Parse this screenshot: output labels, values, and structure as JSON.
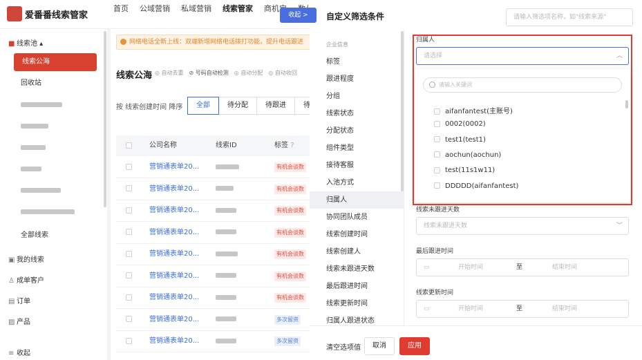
{
  "app": {
    "brand": "爱番番线索管家"
  },
  "topnav": [
    "首页",
    "公域营销",
    "私域营销",
    "线索管家",
    "商机宝",
    "数从"
  ],
  "sidebar": {
    "group_pool": "线索池",
    "items": [
      {
        "label": "线索公海",
        "selected": true
      },
      {
        "label": "回收站"
      },
      {
        "label": "全部线索"
      }
    ],
    "my_leads": "我的线索",
    "customers": "成单客户",
    "orders": "订单",
    "products": "产品",
    "collapse": "收起"
  },
  "main": {
    "notice": "网络电话全新上线：双端新增网络电话拨打功能，提升电话跟进",
    "title": "线索公海",
    "options": [
      "自动去重",
      "号码自动检测",
      "自动分配",
      "自动收回"
    ],
    "sort_label": "按 线索创建时间 降序",
    "tabs": [
      "全部",
      "待分配",
      "待跟进",
      "待"
    ],
    "columns": [
      "公司名称",
      "线索ID",
      "标签"
    ],
    "rows": [
      {
        "company": "营销通表单20...",
        "tag": "有机会谈数",
        "tag_color": "red"
      },
      {
        "company": "营销通表单20...",
        "tag": "有机会谈数",
        "tag_color": "red"
      },
      {
        "company": "营销通表单20...",
        "tag": "有机会谈数",
        "tag_color": "red"
      },
      {
        "company": "营销通表单20...",
        "tag": "有机会谈数",
        "tag_color": "red"
      },
      {
        "company": "营销通表单20...",
        "tag": "有机会谈数",
        "tag_color": "red"
      },
      {
        "company": "营销通表单20...",
        "tag": "有机会谈数",
        "tag_color": "red"
      },
      {
        "company": "营销通表单20...",
        "tag": "有机会谈数",
        "tag_color": "red"
      },
      {
        "company": "营销通表单20...",
        "tag": "多次留资",
        "tag_color": "blue"
      },
      {
        "company": "营销通表单20...",
        "tag": "多次留资",
        "tag_color": "blue"
      }
    ]
  },
  "filter": {
    "title": "自定义筛选条件",
    "search_placeholder": "请输入筛选项名称，如\"线索来源\"",
    "collapse_label": "收起 >",
    "categories": [
      {
        "label": "企业信息",
        "header": true
      },
      {
        "label": "标签"
      },
      {
        "label": "跟进程度"
      },
      {
        "label": "分组"
      },
      {
        "label": "线索状态"
      },
      {
        "label": "分配状态"
      },
      {
        "label": "组件类型"
      },
      {
        "label": "接待客服"
      },
      {
        "label": "入池方式"
      },
      {
        "label": "归属人",
        "selected": true
      },
      {
        "label": "协同团队成员"
      },
      {
        "label": "线索创建时间"
      },
      {
        "label": "线索创建人"
      },
      {
        "label": "线索未跟进天数"
      },
      {
        "label": "最后跟进时间"
      },
      {
        "label": "线索更新时间"
      },
      {
        "label": "归属人跟进状态"
      }
    ],
    "owner": {
      "label": "归属人",
      "placeholder": "请选择",
      "search_placeholder": "请输入关键词",
      "options": [
        "aifanfantest(主账号)",
        "0002(0002)",
        "test1(test1)",
        "aochun(aochun)",
        "test(11s1w11)",
        "DDDDD(aifanfantest)"
      ]
    },
    "not_followed_days": {
      "label": "线索未跟进天数",
      "placeholder": "线索未跟进天数"
    },
    "last_follow_time": {
      "label": "最后跟进时间",
      "start": "开始时间",
      "sep": "至",
      "end": "结束时间"
    },
    "update_time": {
      "label": "线索更新时间",
      "start": "开始时间",
      "sep": "至",
      "end": "结束时间"
    },
    "footer": {
      "clear": "清空选项值",
      "cancel": "取消",
      "apply": "应用"
    }
  },
  "colors": {
    "accent": "#d8402f",
    "primary": "#4a6ee0",
    "highlight_box": "#e03b2f"
  }
}
